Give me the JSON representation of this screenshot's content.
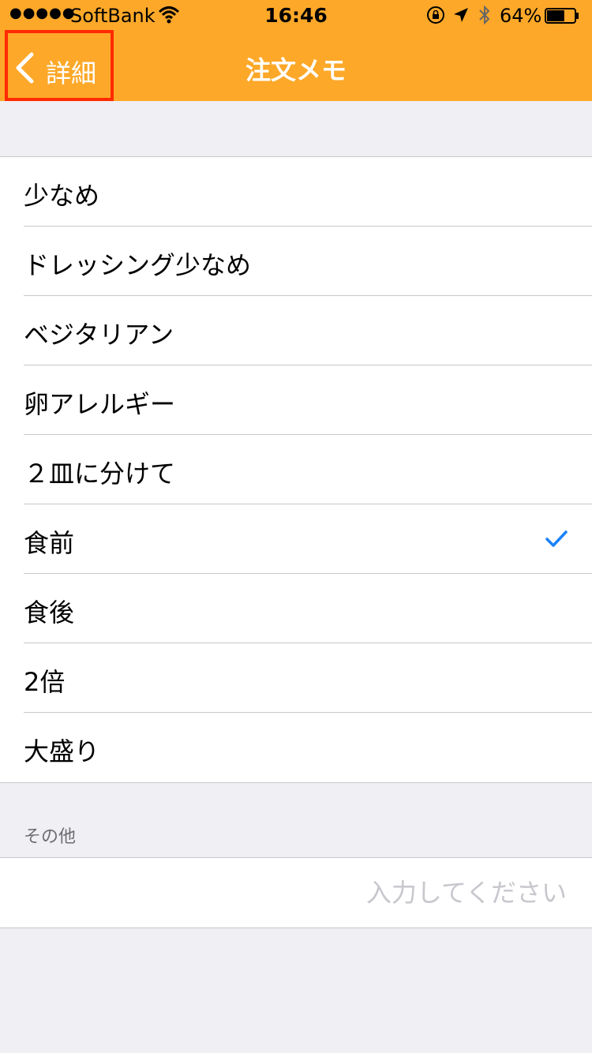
{
  "status": {
    "carrier": "SoftBank",
    "time": "16:46",
    "battery": "64%",
    "battery_level": 0.64
  },
  "nav": {
    "back_label": "詳細",
    "title": "注文メモ"
  },
  "options": [
    {
      "label": "少なめ",
      "checked": false
    },
    {
      "label": "ドレッシング少なめ",
      "checked": false
    },
    {
      "label": "ベジタリアン",
      "checked": false
    },
    {
      "label": "卵アレルギー",
      "checked": false
    },
    {
      "label": "２皿に分けて",
      "checked": false
    },
    {
      "label": "食前",
      "checked": true
    },
    {
      "label": "食後",
      "checked": false
    },
    {
      "label": "2倍",
      "checked": false
    },
    {
      "label": "大盛り",
      "checked": false
    }
  ],
  "other": {
    "header": "その他",
    "placeholder": "入力してください",
    "value": ""
  },
  "colors": {
    "nav_bg": "#fda829",
    "highlight_border": "#ff2a00",
    "checkmark": "#1a82fb"
  }
}
